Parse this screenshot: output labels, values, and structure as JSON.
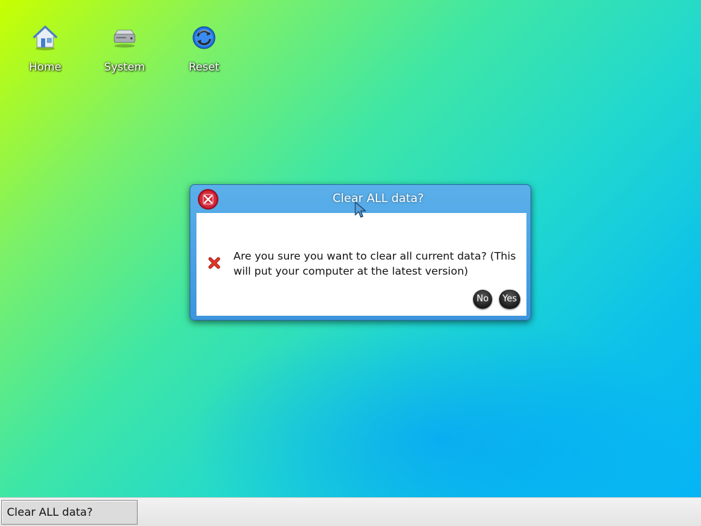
{
  "desktop": {
    "icons": [
      {
        "label": "Home",
        "icon": "house-icon"
      },
      {
        "label": "System",
        "icon": "hard-drive-icon"
      },
      {
        "label": "Reset",
        "icon": "refresh-icon"
      }
    ]
  },
  "dialog": {
    "title": "Clear ALL data?",
    "message": "Are you sure you want to clear all current data? (This will put your computer at the latest version)",
    "message_icon": "error-x-icon",
    "close_icon": "close-icon",
    "buttons": {
      "no_label": "No",
      "yes_label": "Yes"
    }
  },
  "taskbar": {
    "active_task_label": "Clear ALL data?"
  },
  "colors": {
    "dialog_titlebar": "#4ba2e3",
    "close_button": "#c4182c",
    "error_icon": "#e3342a",
    "button_dark": "#2a2a2a"
  }
}
